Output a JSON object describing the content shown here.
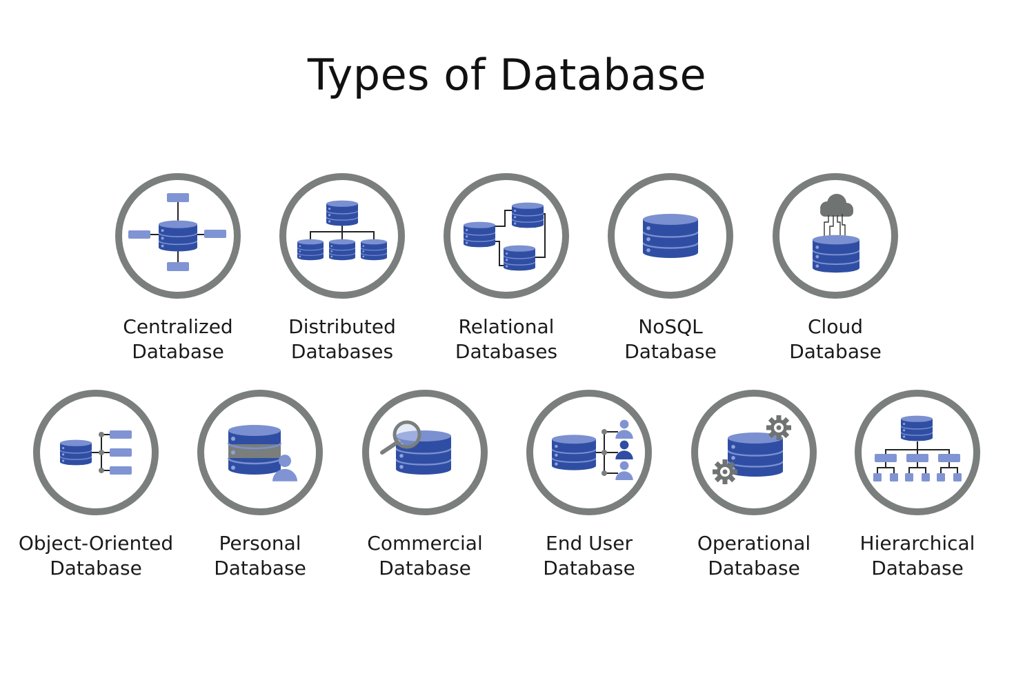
{
  "title": "Types of Database",
  "colors": {
    "ring": "#7a7e7c",
    "db_dark": "#2f4ea3",
    "db_light": "#7b90d1",
    "box": "#8094d4",
    "line": "#222222",
    "gear": "#6f7371"
  },
  "rows": [
    {
      "items": [
        {
          "icon": "centralized-database-icon",
          "line1": "Centralized",
          "line2": "Database"
        },
        {
          "icon": "distributed-databases-icon",
          "line1": "Distributed",
          "line2": "Databases"
        },
        {
          "icon": "relational-databases-icon",
          "line1": "Relational",
          "line2": "Databases"
        },
        {
          "icon": "nosql-database-icon",
          "line1": "NoSQL",
          "line2": "Database"
        },
        {
          "icon": "cloud-database-icon",
          "line1": "Cloud",
          "line2": "Database"
        }
      ]
    },
    {
      "items": [
        {
          "icon": "object-oriented-database-icon",
          "line1": "Object-Oriented",
          "line2": "Database"
        },
        {
          "icon": "personal-database-icon",
          "line1": "Personal",
          "line2": "Database"
        },
        {
          "icon": "commercial-database-icon",
          "line1": "Commercial",
          "line2": "Database"
        },
        {
          "icon": "end-user-database-icon",
          "line1": "End User",
          "line2": "Database"
        },
        {
          "icon": "operational-database-icon",
          "line1": "Operational",
          "line2": "Database"
        },
        {
          "icon": "hierarchical-database-icon",
          "line1": "Hierarchical",
          "line2": "Database"
        }
      ]
    }
  ]
}
